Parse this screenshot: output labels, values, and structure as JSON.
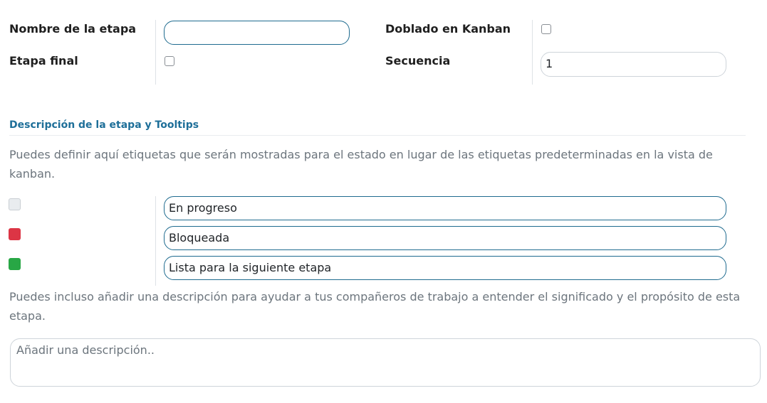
{
  "form": {
    "stage_name_label": "Nombre de la etapa",
    "stage_name_value": "",
    "final_stage_label": "Etapa final",
    "final_stage_checked": false,
    "folded_kanban_label": "Doblado en Kanban",
    "folded_kanban_checked": false,
    "sequence_label": "Secuencia",
    "sequence_value": "1"
  },
  "section": {
    "title": "Descripción de la etapa y Tooltips",
    "intro": "Puedes definir aquí etiquetas que serán mostradas para el estado en lugar de las etiquetas predeterminadas en la vista de kanban."
  },
  "states": [
    {
      "color": "#e9ecef",
      "value": "En progreso"
    },
    {
      "color": "#dc3545",
      "value": "Bloqueada"
    },
    {
      "color": "#28a745",
      "value": "Lista para la siguiente etapa"
    }
  ],
  "description": {
    "help": "Puedes incluso añadir una descripción para ayudar a tus compañeros de trabajo a entender el significado y el propósito de esta etapa.",
    "placeholder": "Añadir una descripción.."
  }
}
